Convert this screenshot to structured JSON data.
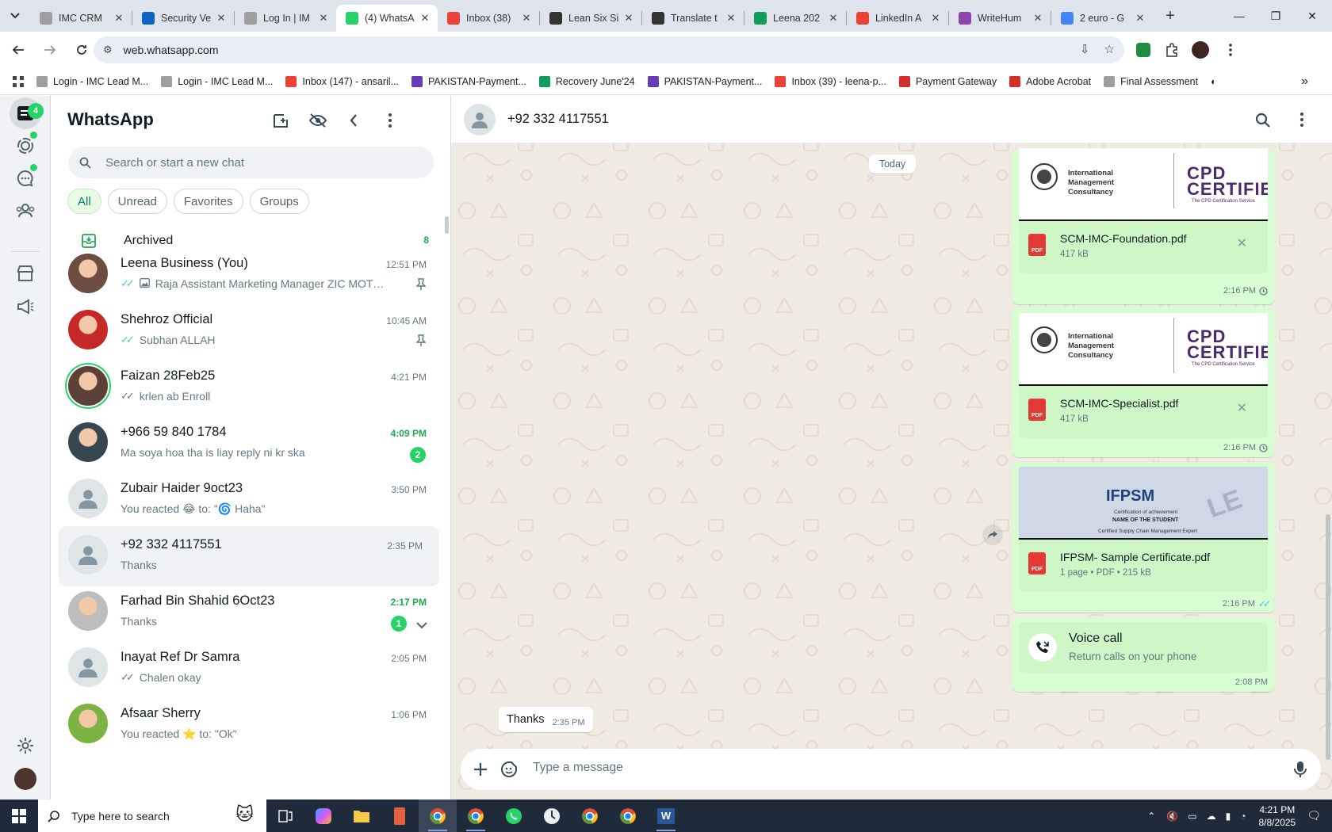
{
  "browser": {
    "tabs": [
      {
        "title": "IMC CRM",
        "icon": "imc-icon",
        "color": "#9e9e9e"
      },
      {
        "title": "Security Ve",
        "icon": "linkedin-icon",
        "color": "#0a66c2"
      },
      {
        "title": "Log In | IM",
        "icon": "imc-icon",
        "color": "#9e9e9e"
      },
      {
        "title": "(4) WhatsA",
        "icon": "whatsapp-icon",
        "color": "#25d366",
        "active": true
      },
      {
        "title": "Inbox (38)",
        "icon": "gmail-icon",
        "color": "#ea4335"
      },
      {
        "title": "Lean Six Si",
        "icon": "openai-icon",
        "color": "#333333"
      },
      {
        "title": "Translate t",
        "icon": "openai-icon",
        "color": "#333333"
      },
      {
        "title": "Leena 202",
        "icon": "sheets-icon",
        "color": "#0f9d58"
      },
      {
        "title": "LinkedIn A",
        "icon": "gmail-icon",
        "color": "#ea4335"
      },
      {
        "title": "WriteHum",
        "icon": "writehuman-icon",
        "color": "#8e44ad"
      },
      {
        "title": "2 euro - G",
        "icon": "google-icon",
        "color": "#4285f4"
      }
    ],
    "url": "web.whatsapp.com",
    "bookmarks": [
      {
        "label": "Login - IMC Lead M...",
        "icon": "imc-icon",
        "color": "#9e9e9e"
      },
      {
        "label": "Login - IMC Lead M...",
        "icon": "imc-icon",
        "color": "#9e9e9e"
      },
      {
        "label": "Inbox (147) - ansaril...",
        "icon": "gmail-icon",
        "color": "#ea4335"
      },
      {
        "label": "PAKISTAN-Payment...",
        "icon": "forms-icon",
        "color": "#673ab7"
      },
      {
        "label": "Recovery June'24",
        "icon": "sheets-icon",
        "color": "#0f9d58"
      },
      {
        "label": "PAKISTAN-Payment...",
        "icon": "forms-icon",
        "color": "#673ab7"
      },
      {
        "label": "Inbox (39) - leena-p...",
        "icon": "gmail-icon",
        "color": "#ea4335"
      },
      {
        "label": "Payment Gateway",
        "icon": "acrobat-icon",
        "color": "#d32f2f"
      },
      {
        "label": "Adobe Acrobat",
        "icon": "acrobat-icon",
        "color": "#d32f2f"
      },
      {
        "label": "Final Assessment",
        "icon": "imc-icon",
        "color": "#9e9e9e"
      }
    ]
  },
  "whatsapp": {
    "rail": {
      "chats_badge": "4"
    },
    "title": "WhatsApp",
    "search_placeholder": "Search or start a new chat",
    "filters": [
      "All",
      "Unread",
      "Favorites",
      "Groups"
    ],
    "archived": {
      "label": "Archived",
      "count": "8"
    },
    "chats": [
      {
        "name": "Leena Business (You)",
        "time": "12:51 PM",
        "preview": "Raja Assistant Marketing Manager ZIC MOTOR O...",
        "ticks": "blue",
        "photo_icon": true,
        "pinned": true,
        "avatar_color": "#6d4c41"
      },
      {
        "name": "Shehroz Official",
        "time": "10:45 AM",
        "preview": "Subhan ALLAH",
        "ticks": "blue",
        "pinned": true,
        "avatar_color": "#c62828"
      },
      {
        "name": "Faizan 28Feb25",
        "time": "4:21 PM",
        "preview": "krlen ab Enroll",
        "ticks": "grey",
        "avatar_color": "#5d4037",
        "status_ring": true
      },
      {
        "name": "+966 59 840 1784",
        "time": "4:09 PM",
        "preview": "Ma soya hoa tha is liay reply ni kr ska",
        "unread": "2",
        "avatar_color": "#37474f"
      },
      {
        "name": "Zubair Haider 9oct23",
        "time": "3:50 PM",
        "preview": "You reacted 😂 to: \"🌀 Haha\"",
        "default_avatar": true
      },
      {
        "name": "+92 332 4117551",
        "time": "2:35 PM",
        "preview": "Thanks",
        "default_avatar": true,
        "selected": true
      },
      {
        "name": "Farhad Bin Shahid 6Oct23",
        "time": "2:17 PM",
        "preview": "Thanks",
        "unread": "1",
        "chevron": true,
        "avatar_color": "#bdbdbd"
      },
      {
        "name": "Inayat Ref Dr Samra",
        "time": "2:05 PM",
        "preview": "Chalen okay",
        "ticks": "grey",
        "default_avatar": true
      },
      {
        "name": "Afsaar Sherry",
        "time": "1:06 PM",
        "preview": "You reacted ⭐ to: \"Ok\"",
        "avatar_color": "#7cb342"
      }
    ],
    "conversation": {
      "contact": "+92 332 4117551",
      "date_chip": "Today",
      "documents": [
        {
          "org": "International Management Consultancy",
          "cert": "CPD CERTIFIED",
          "cert_sub": "The CPD Certification Service",
          "filename": "SCM-IMC-Foundation.pdf",
          "meta": "417 kB",
          "time": "2:16 PM",
          "status": "pending"
        },
        {
          "org": "International Management Consultancy",
          "cert": "CPD CERTIFIED",
          "cert_sub": "The CPD Certification Service",
          "filename": "SCM-IMC-Specialist.pdf",
          "meta": "417 kB",
          "time": "2:16 PM",
          "status": "pending"
        },
        {
          "logo": "IFPSM",
          "line1": "Certification of achievement",
          "line2": "NAME OF THE STUDENT",
          "line3": "Certified Supply Chain Management Expert",
          "watermark": "LE",
          "filename": "IFPSM- Sample Certificate.pdf",
          "meta": "1 page • PDF • 215 kB",
          "time": "2:16 PM",
          "status": "read"
        }
      ],
      "voice_call": {
        "title": "Voice call",
        "subtitle": "Return calls on your phone",
        "time": "2:08 PM"
      },
      "incoming": {
        "text": "Thanks",
        "time": "2:35 PM"
      },
      "compose_placeholder": "Type a message"
    }
  },
  "taskbar": {
    "search_placeholder": "Type here to search",
    "time": "4:21 PM",
    "date": "8/8/2025"
  }
}
